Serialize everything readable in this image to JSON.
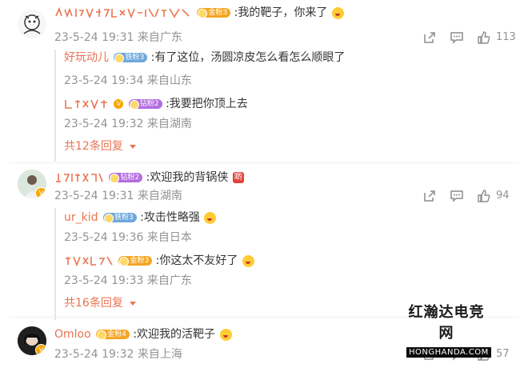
{
  "comments": [
    {
      "badge": "金粉3",
      "text": ":我的靶子，你来了",
      "time": "23-5-24 19:31",
      "location": "来自广东",
      "likes": "113",
      "replies": [
        {
          "name": "好玩动儿",
          "badge": "铁粉3",
          "text": ":有了这位，汤圆凉皮怎么看怎么顺眼了",
          "time": "23-5-24 19:34",
          "location": "来自山东"
        },
        {
          "badge": "钻粉2",
          "text": ":我要把你顶上去",
          "time": "23-5-24 19:32",
          "location": "来自湖南"
        }
      ],
      "more_replies": "共12条回复"
    },
    {
      "badge": "钻粉2",
      "text": ":欢迎我的背锅侠",
      "sticker": "啲",
      "time": "23-5-24 19:31",
      "location": "来自湖南",
      "likes": "94",
      "replies": [
        {
          "name": "ur_kid",
          "badge": "铁粉3",
          "text": ":攻击性略强",
          "time": "23-5-24 19:36",
          "location": "来自日本"
        },
        {
          "badge": "金粉3",
          "text": ":你这太不友好了",
          "time": "23-5-24 19:33",
          "location": "来自广东"
        }
      ],
      "more_replies": "共16条回复"
    },
    {
      "name": "Omloo",
      "badge": "金粉4",
      "text": ":欢迎我的活靶子",
      "time": "23-5-24 19:32",
      "location": "来自上海",
      "likes": "57"
    }
  ],
  "watermark": {
    "cn": "红瀚达电竞网",
    "en": "HONGHANDA.COM"
  },
  "icons": {
    "share": "share-icon",
    "comment": "comment-icon",
    "like": "thumbs-up-icon",
    "more": "chevron-down-icon"
  },
  "colors": {
    "username": "#eb7350",
    "meta": "#939393",
    "text": "#333333"
  }
}
